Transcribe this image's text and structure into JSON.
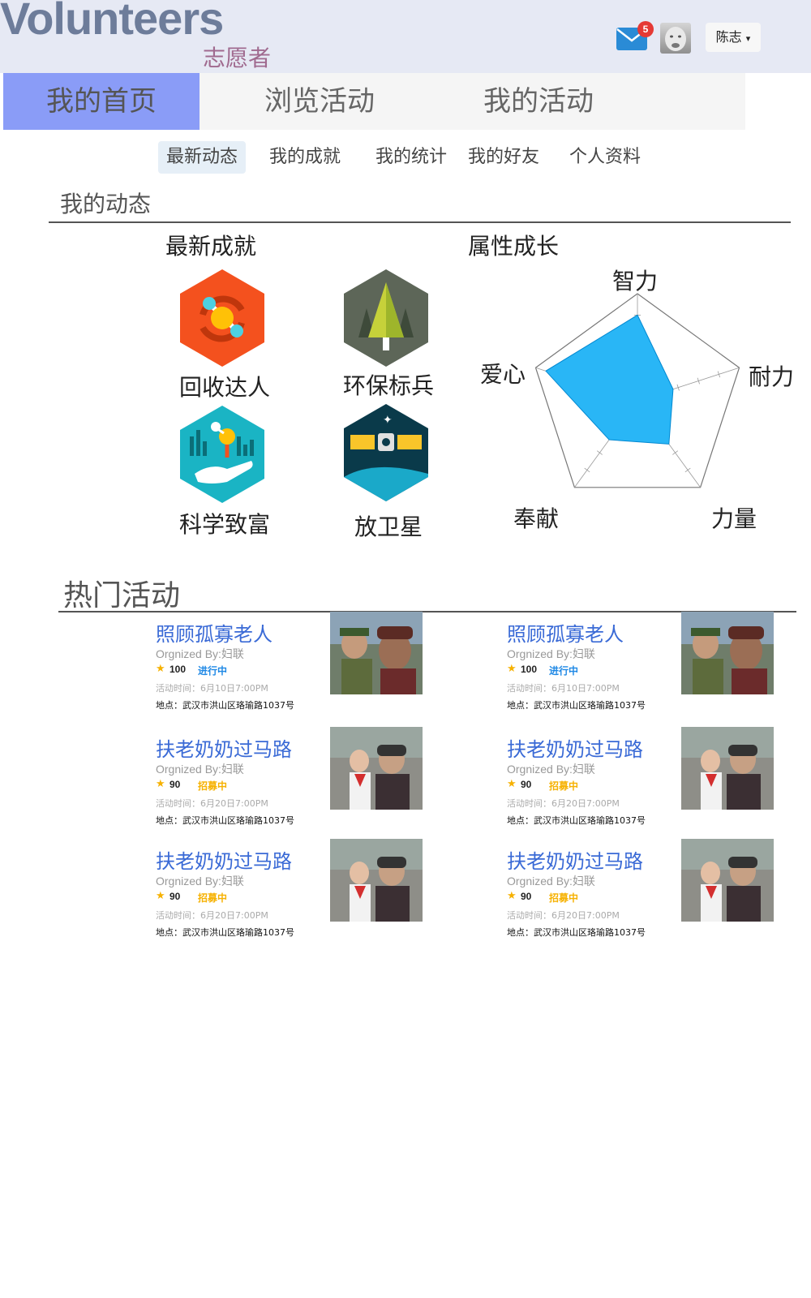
{
  "header": {
    "brand_en": "Volunteers",
    "brand_cn": "志愿者",
    "mail_count": "5",
    "user_name": "陈志",
    "user_caret": "▾"
  },
  "nav": {
    "tabs": [
      {
        "label": "我的首页",
        "active": true
      },
      {
        "label": "浏览活动",
        "active": false
      },
      {
        "label": "我的活动",
        "active": false
      }
    ]
  },
  "subnav": {
    "items": [
      {
        "label": "最新动态",
        "active": true
      },
      {
        "label": "我的成就",
        "active": false
      },
      {
        "label": "我的统计",
        "active": false
      },
      {
        "label": "我的好友",
        "active": false
      },
      {
        "label": "个人资料",
        "active": false
      }
    ]
  },
  "dynamics": {
    "title": "我的动态",
    "achievements_title": "最新成就",
    "achievements": [
      {
        "name": "回收达人",
        "icon": "recycle-icon"
      },
      {
        "name": "环保标兵",
        "icon": "tree-icon"
      },
      {
        "name": "科学致富",
        "icon": "science-hand-icon"
      },
      {
        "name": "放卫星",
        "icon": "satellite-icon"
      }
    ],
    "growth_title": "属性成长",
    "radar": {
      "axes": [
        "智力",
        "耐力",
        "力量",
        "奉献",
        "爱心"
      ],
      "values": [
        0.8,
        0.35,
        0.5,
        0.45,
        0.9
      ],
      "max": 1,
      "fill_color": "#29b6f6"
    }
  },
  "hot": {
    "title": "热门活动",
    "labels": {
      "org_prefix": "Orgnized By:",
      "time_prefix": "活动时间：",
      "place_prefix": "地点："
    },
    "activities": [
      {
        "title": "照顾孤寡老人",
        "org": "妇联",
        "score": "100",
        "status": "进行中",
        "status_color": "#1e88e5",
        "time": "6月10日7:00PM",
        "place": "武汉市洪山区珞瑜路1037号",
        "photo": "photo-elder-soldier"
      },
      {
        "title": "照顾孤寡老人",
        "org": "妇联",
        "score": "100",
        "status": "进行中",
        "status_color": "#1e88e5",
        "time": "6月10日7:00PM",
        "place": "武汉市洪山区珞瑜路1037号",
        "photo": "photo-elder-soldier"
      },
      {
        "title": "扶老奶奶过马路",
        "org": "妇联",
        "score": "90",
        "status": "招募中",
        "status_color": "#f6b100",
        "time": "6月20日7:00PM",
        "place": "武汉市洪山区珞瑜路1037号",
        "photo": "photo-child-grandma"
      },
      {
        "title": "扶老奶奶过马路",
        "org": "妇联",
        "score": "90",
        "status": "招募中",
        "status_color": "#f6b100",
        "time": "6月20日7:00PM",
        "place": "武汉市洪山区珞瑜路1037号",
        "photo": "photo-child-grandma"
      },
      {
        "title": "扶老奶奶过马路",
        "org": "妇联",
        "score": "90",
        "status": "招募中",
        "status_color": "#f6b100",
        "time": "6月20日7:00PM",
        "place": "武汉市洪山区珞瑜路1037号",
        "photo": "photo-child-grandma"
      },
      {
        "title": "扶老奶奶过马路",
        "org": "妇联",
        "score": "90",
        "status": "招募中",
        "status_color": "#f6b100",
        "time": "6月20日7:00PM",
        "place": "武汉市洪山区珞瑜路1037号",
        "photo": "photo-child-grandma"
      }
    ]
  }
}
